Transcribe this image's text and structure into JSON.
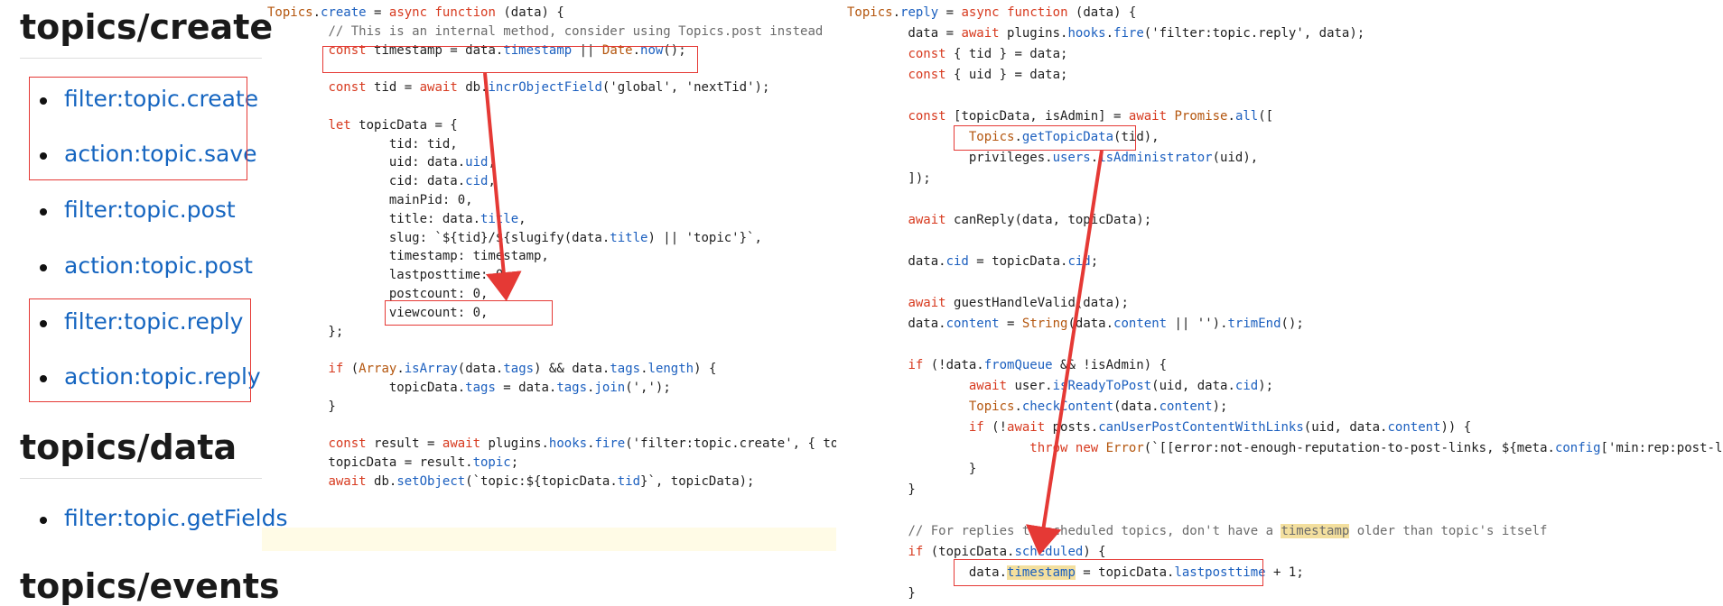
{
  "sidebar": {
    "sections": [
      {
        "title": "topics/create"
      },
      {
        "title": "topics/data"
      },
      {
        "title": "topics/events"
      }
    ],
    "hooks": [
      {
        "label": "filter:topic.create"
      },
      {
        "label": "action:topic.save"
      },
      {
        "label": "filter:topic.post"
      },
      {
        "label": "action:topic.post"
      },
      {
        "label": "filter:topic.reply"
      },
      {
        "label": "action:topic.reply"
      },
      {
        "label": "filter:topic.getFields"
      }
    ]
  },
  "code_create": {
    "lines": [
      "Topics.create = async function (data) {",
      "        // This is an internal method, consider using Topics.post instead",
      "        const timestamp = data.timestamp || Date.now();",
      "",
      "        const tid = await db.incrObjectField('global', 'nextTid');",
      "",
      "        let topicData = {",
      "                tid: tid,",
      "                uid: data.uid,",
      "                cid: data.cid,",
      "                mainPid: 0,",
      "                title: data.title,",
      "                slug: `${tid}/${slugify(data.title) || 'topic'}`,",
      "                timestamp: timestamp,",
      "                lastposttime: 0,",
      "                postcount: 0,",
      "                viewcount: 0,",
      "        };",
      "",
      "        if (Array.isArray(data.tags) && data.tags.length) {",
      "                topicData.tags = data.tags.join(',');",
      "        }",
      "",
      "        const result = await plugins.hooks.fire('filter:topic.create', { to",
      "        topicData = result.topic;",
      "        await db.setObject(`topic:${topicData.tid}`, topicData);"
    ]
  },
  "code_reply": {
    "lines": [
      "Topics.reply = async function (data) {",
      "        data = await plugins.hooks.fire('filter:topic.reply', data);",
      "        const { tid } = data;",
      "        const { uid } = data;",
      "",
      "        const [topicData, isAdmin] = await Promise.all([",
      "                Topics.getTopicData(tid),",
      "                privileges.users.isAdministrator(uid),",
      "        ]);",
      "",
      "        await canReply(data, topicData);",
      "",
      "        data.cid = topicData.cid;",
      "",
      "        await guestHandleValid(data);",
      "        data.content = String(data.content || '').trimEnd();",
      "",
      "        if (!data.fromQueue && !isAdmin) {",
      "                await user.isReadyToPost(uid, data.cid);",
      "                Topics.checkContent(data.content);",
      "                if (!await posts.canUserPostContentWithLinks(uid, data.content)) {",
      "                        throw new Error(`[[error:not-enough-reputation-to-post-links, ${meta.config['min:rep:post-links']}]]`);",
      "                }",
      "        }",
      "",
      "        // For replies to scheduled topics, don't have a timestamp older than topic's itself",
      "        if (topicData.scheduled) {",
      "                data.timestamp = topicData.lastposttime + 1;",
      "        }"
    ]
  },
  "colors": {
    "highlight_box": "#e53935",
    "arrow": "#e53935",
    "link": "#1565c0",
    "keyword": "#d73a1f",
    "property": "#1b5fbf"
  }
}
